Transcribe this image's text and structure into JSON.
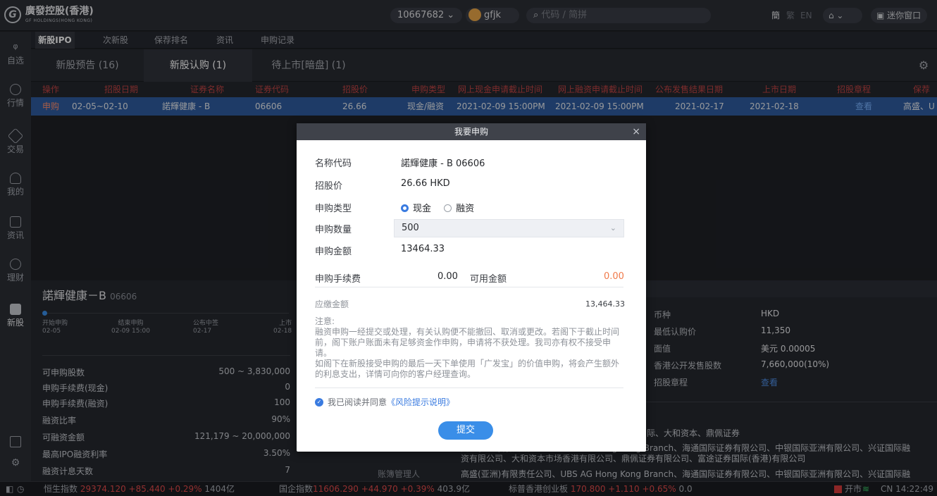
{
  "titlebar": {
    "logo_letter": "G",
    "brand": "廣發控股(香港)",
    "brand_sub": "GF HOLDINGS(HONG KONG)",
    "account": "10667682 ⌄",
    "username": "gfjk",
    "search_placeholder": "代码 / 简拼",
    "lang_simplified": "簡",
    "lang_traditional": "繁",
    "lang_en": "EN",
    "mini_window": "迷你窗口",
    "win_min": "−",
    "win_max": "□",
    "win_close": "✕"
  },
  "leftnav": {
    "items": [
      {
        "label": "自选"
      },
      {
        "label": "行情"
      },
      {
        "label": "交易"
      },
      {
        "label": "我的"
      },
      {
        "label": "资讯"
      },
      {
        "label": "理财"
      },
      {
        "label": "新股"
      }
    ]
  },
  "maintabs": [
    "新股IPO",
    "次新股",
    "保荐排名",
    "资讯",
    "申购记录"
  ],
  "subtabs": [
    "新股预告 (16)",
    "新股认购 (1)",
    "待上市[暗盘] (1)"
  ],
  "table": {
    "headers": [
      "操作",
      "招股日期",
      "证券名称",
      "证券代码",
      "招股价",
      "申购类型",
      "网上现金申请截止时间",
      "网上融资申请截止时间",
      "公布发售结果日期",
      "上市日期",
      "招股章程",
      "保荐"
    ],
    "row": [
      "申购",
      "02-05~02-10",
      "諾輝健康 - B",
      "06606",
      "26.66",
      "现金/融资",
      "2021-02-09 15:00PM",
      "2021-02-09 15:00PM",
      "2021-02-17",
      "2021-02-18",
      "查看",
      "高盛、U"
    ]
  },
  "detail": {
    "title": "諾輝健康－B",
    "code": "06606",
    "timeline": [
      {
        "label": "开始申购",
        "date": "02-05"
      },
      {
        "label": "结束申购",
        "date": "02-09 15:00"
      },
      {
        "label": "公布中签",
        "date": "02-17"
      },
      {
        "label": "上市",
        "date": "02-18"
      }
    ],
    "rows": [
      {
        "label": "可申购股数",
        "value": "500 ~ 3,830,000"
      },
      {
        "label": "申购手续费(现金)",
        "value": "0"
      },
      {
        "label": "申购手续费(融资)",
        "value": "100"
      },
      {
        "label": "融资比率",
        "value": "90%"
      },
      {
        "label": "可融资金额",
        "value": "121,179 ~ 20,000,000"
      },
      {
        "label": "最高IPO融资利率",
        "value": "3.50%"
      },
      {
        "label": "融资计息天数",
        "value": "7"
      }
    ],
    "right_rows": [
      {
        "label": "币种",
        "value": "HKD"
      },
      {
        "label": "最低认购价",
        "value": "11,350"
      },
      {
        "label": "面值",
        "value": "美元 0.00005"
      },
      {
        "label": "香港公开发售股数",
        "value": "7,660,000(10%)"
      },
      {
        "label": "招股章程",
        "value": "查看"
      }
    ],
    "underwriters_tail": "际、大和资本、鼎佩证券",
    "sponsor_line1": "高盛(亚洲)有限责任公司、UBS AG Hong Kong Branch、海通国际证券有限公司、中银国际亚洲有限公司、兴证国际融",
    "sponsor_line2": "资有限公司、大和资本市场香港有限公司、鼎佩证券有限公司、富途证券国际(香港)有限公司",
    "bookrunner_label": "账簿管理人",
    "bookrunner_line": "高盛(亚洲)有限责任公司、UBS AG Hong Kong Branch、海通国际证券有限公司、中银国际亚洲有限公司、兴证国际融"
  },
  "statusbar": {
    "hsi_label": "恒生指数",
    "hsi_value": "29374.120 +85.440 +0.29%",
    "hsi_turnover": "1404亿",
    "hscei_label": "国企指数",
    "hscei_value": "11606.290 +44.970 +0.39%",
    "hscei_turnover": "403.9亿",
    "gem_label": "标普香港创业板",
    "gem_value": "170.800 +1.110 +0.65%",
    "gem_turnover": "0.0",
    "market_status": "开市",
    "clock": "CN 14:22:49"
  },
  "modal": {
    "title": "我要申购",
    "close": "×",
    "name_label": "名称代码",
    "name_value": "諾輝健康 - B 06606",
    "price_label": "招股价",
    "price_value": "26.66 HKD",
    "type_label": "申购类型",
    "type_options": [
      "现金",
      "融资"
    ],
    "qty_label": "申购数量",
    "qty_value": "500",
    "amount_label": "申购金额",
    "amount_value": "13464.33",
    "fee_label": "申购手续费",
    "fee_value": "0.00",
    "avail_label": "可用金额",
    "avail_value": "0.00",
    "payable_label": "应缴金额",
    "payable_value": "13,464.33",
    "notes_title": "注意:",
    "notes_1": "融资申购一经提交或处理，有关认购便不能撤回、取消或更改。若阁下于截止时间前，阁下账户账面未有足够资金作申购，申请将不获处理。我司亦有权不接受申请。",
    "notes_2": "如阁下在新股接受申购的最后一天下单使用「广发宝」的价值申购，将会产生额外的利息支出，详情可向你的客户经理查询。",
    "agree_text": "我已阅读并同意",
    "agree_link": "《风险提示说明》",
    "submit": "提交"
  }
}
